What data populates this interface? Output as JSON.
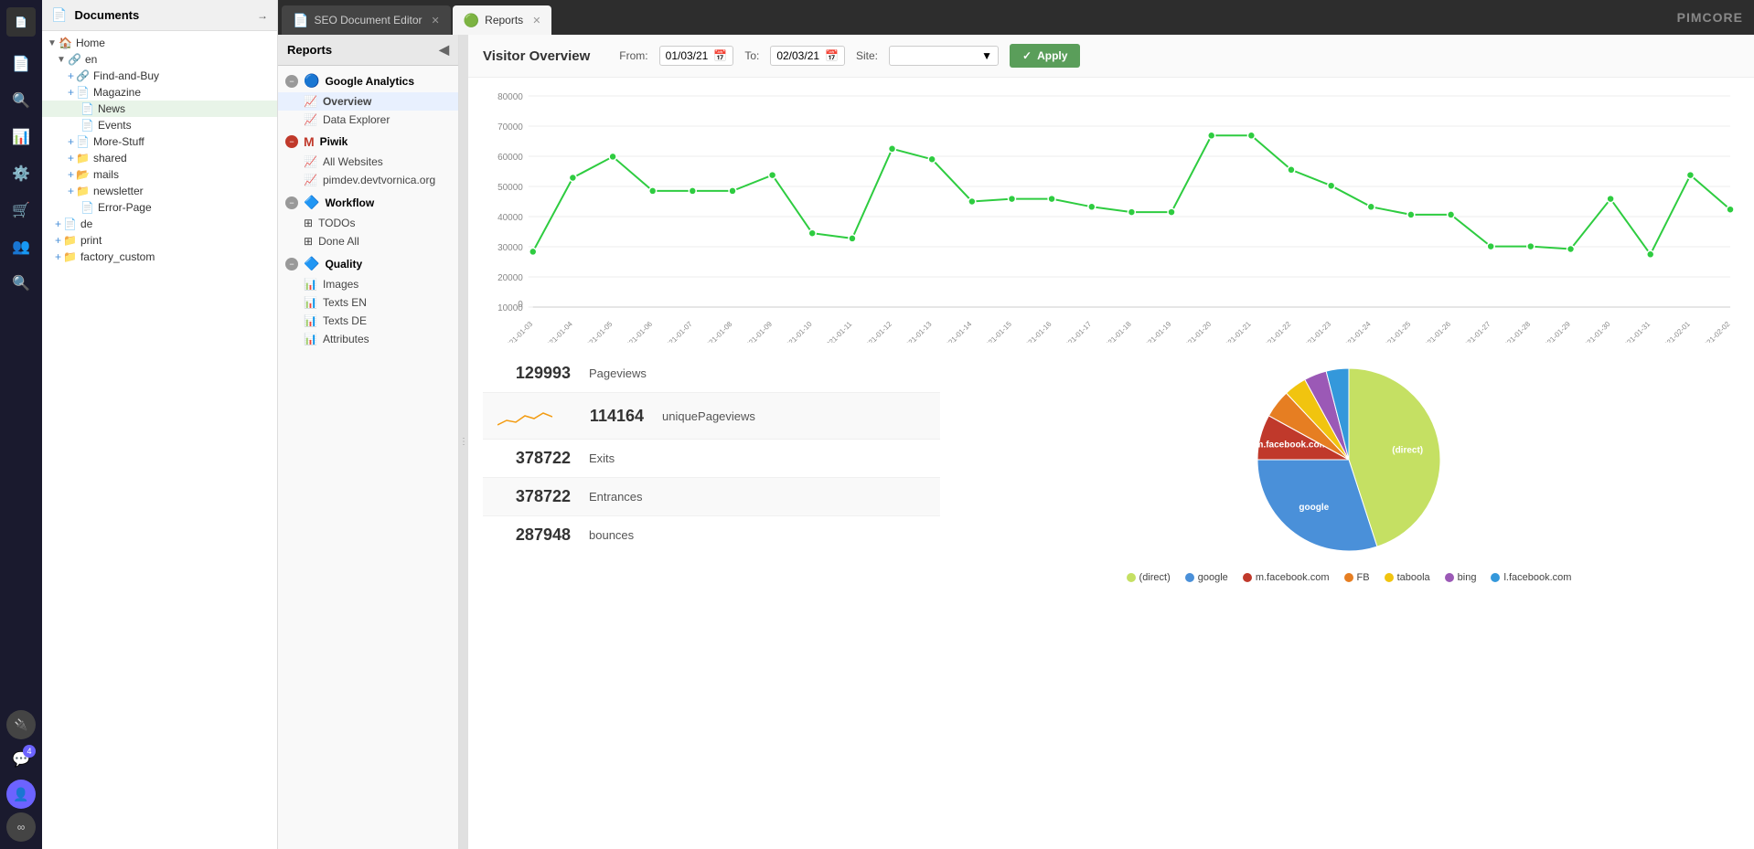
{
  "app": {
    "title": "Pimcore",
    "logo": "PIMCORE"
  },
  "icon_sidebar": {
    "nav_icons": [
      {
        "name": "documents-icon",
        "symbol": "📄",
        "tooltip": "Documents"
      },
      {
        "name": "search-icon",
        "symbol": "🔍",
        "tooltip": "Search"
      },
      {
        "name": "analytics-icon",
        "symbol": "📊",
        "tooltip": "Analytics"
      },
      {
        "name": "settings-icon",
        "symbol": "⚙️",
        "tooltip": "Settings"
      },
      {
        "name": "ecommerce-icon",
        "symbol": "🛒",
        "tooltip": "Ecommerce"
      },
      {
        "name": "users-icon",
        "symbol": "👥",
        "tooltip": "Users"
      },
      {
        "name": "search2-icon",
        "symbol": "🔍",
        "tooltip": "Search"
      }
    ],
    "bottom_icons": [
      {
        "name": "plugin1-icon",
        "symbol": "🔌"
      },
      {
        "name": "chat-icon",
        "symbol": "💬",
        "badge": "4"
      },
      {
        "name": "user-avatar-icon",
        "symbol": "👤"
      },
      {
        "name": "plugin2-icon",
        "symbol": "∞"
      }
    ]
  },
  "docs_panel": {
    "title": "Documents",
    "tree": [
      {
        "id": "home",
        "label": "Home",
        "type": "folder",
        "level": 0,
        "icon": "🏠"
      },
      {
        "id": "en",
        "label": "en",
        "type": "link",
        "level": 1,
        "icon": "🔗"
      },
      {
        "id": "find-and-buy",
        "label": "Find-and-Buy",
        "type": "link",
        "level": 2,
        "icon": "🔗",
        "addable": true
      },
      {
        "id": "magazine",
        "label": "Magazine",
        "type": "doc",
        "level": 2,
        "icon": "📄",
        "addable": true
      },
      {
        "id": "news",
        "label": "News",
        "type": "doc",
        "level": 2,
        "icon": "📄"
      },
      {
        "id": "events",
        "label": "Events",
        "type": "doc",
        "level": 2,
        "icon": "📄"
      },
      {
        "id": "more-stuff",
        "label": "More-Stuff",
        "type": "doc",
        "level": 2,
        "icon": "📄",
        "addable": true
      },
      {
        "id": "shared",
        "label": "shared",
        "type": "folder",
        "level": 2,
        "icon": "📁",
        "addable": true
      },
      {
        "id": "mails",
        "label": "mails",
        "type": "folder",
        "level": 2,
        "icon": "📂",
        "addable": true
      },
      {
        "id": "newsletter",
        "label": "newsletter",
        "type": "folder",
        "level": 2,
        "icon": "📁",
        "addable": true
      },
      {
        "id": "error-page",
        "label": "Error-Page",
        "type": "doc",
        "level": 2,
        "icon": "📄"
      },
      {
        "id": "de",
        "label": "de",
        "type": "doc",
        "level": 1,
        "icon": "📄",
        "addable": true
      },
      {
        "id": "print",
        "label": "print",
        "type": "folder",
        "level": 1,
        "icon": "📁",
        "addable": true
      },
      {
        "id": "factory_custom",
        "label": "factory_custom",
        "type": "folder",
        "level": 1,
        "icon": "📁",
        "addable": true
      }
    ]
  },
  "tabs": [
    {
      "id": "seo-editor",
      "label": "SEO Document Editor",
      "active": false,
      "color": "#4a90d9"
    },
    {
      "id": "reports",
      "label": "Reports",
      "active": true,
      "color": "#4caf50"
    }
  ],
  "reports_panel": {
    "title": "Reports",
    "sections": [
      {
        "id": "google-analytics",
        "label": "Google Analytics",
        "icon": "🔵",
        "collapsed": false,
        "items": [
          {
            "id": "overview",
            "label": "Overview",
            "icon": "📈",
            "active": true
          },
          {
            "id": "data-explorer",
            "label": "Data Explorer",
            "icon": "📈"
          }
        ]
      },
      {
        "id": "piwik",
        "label": "Piwik",
        "icon": "🟥",
        "collapsed": false,
        "items": [
          {
            "id": "all-websites",
            "label": "All Websites",
            "icon": "📈"
          },
          {
            "id": "pimdev",
            "label": "pimdev.devtvornica.org",
            "icon": "📈"
          }
        ]
      },
      {
        "id": "workflow",
        "label": "Workflow",
        "icon": "🔷",
        "collapsed": false,
        "items": [
          {
            "id": "todos",
            "label": "TODOs",
            "icon": "⊞"
          },
          {
            "id": "done-all",
            "label": "Done All",
            "icon": "⊞"
          }
        ]
      },
      {
        "id": "quality",
        "label": "Quality",
        "icon": "🔷",
        "collapsed": false,
        "items": [
          {
            "id": "images",
            "label": "Images",
            "icon": "📊"
          },
          {
            "id": "texts-en",
            "label": "Texts EN",
            "icon": "📊"
          },
          {
            "id": "texts-de",
            "label": "Texts DE",
            "icon": "📊"
          },
          {
            "id": "attributes",
            "label": "Attributes",
            "icon": "📊"
          }
        ]
      }
    ]
  },
  "visitor_overview": {
    "title": "Visitor Overview",
    "from_label": "From:",
    "from_value": "01/03/21",
    "to_label": "To:",
    "to_value": "02/03/21",
    "site_label": "Site:",
    "site_placeholder": "",
    "apply_label": "Apply"
  },
  "chart": {
    "y_labels": [
      "80000",
      "70000",
      "60000",
      "50000",
      "40000",
      "30000",
      "20000",
      "10000",
      "0"
    ],
    "x_labels": [
      "2021-01-03",
      "2021-01-04",
      "2021-01-05",
      "2021-01-06",
      "2021-01-07",
      "2021-01-08",
      "2021-01-09",
      "2021-01-10",
      "2021-01-11",
      "2021-01-12",
      "2021-01-13",
      "2021-01-14",
      "2021-01-15",
      "2021-01-16",
      "2021-01-17",
      "2021-01-18",
      "2021-01-19",
      "2021-01-20",
      "2021-01-21",
      "2021-01-22",
      "2021-01-23",
      "2021-01-24",
      "2021-01-25",
      "2021-01-26",
      "2021-01-27",
      "2021-01-28",
      "2021-01-29",
      "2021-01-30",
      "2021-01-31",
      "2021-02-01",
      "2021-02-02"
    ],
    "data_points": [
      21000,
      49000,
      57000,
      44000,
      44000,
      44000,
      50000,
      28000,
      26000,
      60000,
      56000,
      40000,
      41000,
      41000,
      38000,
      36000,
      36000,
      65000,
      65000,
      52000,
      46000,
      38000,
      35000,
      35000,
      23000,
      23000,
      22000,
      41000,
      20000,
      50000,
      37000
    ],
    "max": 80000
  },
  "stats": [
    {
      "id": "pageviews",
      "number": "129993",
      "label": "Pageviews",
      "has_sparkline": false,
      "alt": false
    },
    {
      "id": "unique-pageviews",
      "number": "114164",
      "label": "uniquePageviews",
      "has_sparkline": true,
      "alt": true
    },
    {
      "id": "exits",
      "number": "378722",
      "label": "Exits",
      "has_sparkline": false,
      "alt": false
    },
    {
      "id": "entrances",
      "number": "378722",
      "label": "Entrances",
      "has_sparkline": false,
      "alt": true
    },
    {
      "id": "bounces",
      "number": "287948",
      "label": "bounces",
      "has_sparkline": false,
      "alt": false
    }
  ],
  "pie_chart": {
    "segments": [
      {
        "label": "(direct)",
        "color": "#c5e063",
        "value": 45,
        "start": 0,
        "end": 165
      },
      {
        "label": "google",
        "color": "#4a90d9",
        "value": 30,
        "start": 165,
        "end": 273
      },
      {
        "label": "m.facebook.com",
        "color": "#c0392b",
        "value": 8,
        "start": 273,
        "end": 302
      },
      {
        "label": "FB",
        "color": "#e67e22",
        "value": 5,
        "start": 302,
        "end": 320
      },
      {
        "label": "taboola",
        "color": "#f1c40f",
        "value": 4,
        "start": 320,
        "end": 334
      },
      {
        "label": "bing",
        "color": "#9b59b6",
        "value": 4,
        "start": 334,
        "end": 348
      },
      {
        "label": "l.facebook.com",
        "color": "#3498db",
        "value": 4,
        "start": 348,
        "end": 360
      }
    ]
  },
  "legend": [
    {
      "label": "(direct)",
      "color": "#c5e063"
    },
    {
      "label": "google",
      "color": "#4a90d9"
    },
    {
      "label": "m.facebook.com",
      "color": "#c0392b"
    },
    {
      "label": "FB",
      "color": "#e67e22"
    },
    {
      "label": "taboola",
      "color": "#f1c40f"
    },
    {
      "label": "bing",
      "color": "#9b59b6"
    },
    {
      "label": "l.facebook.com",
      "color": "#3498db"
    }
  ]
}
